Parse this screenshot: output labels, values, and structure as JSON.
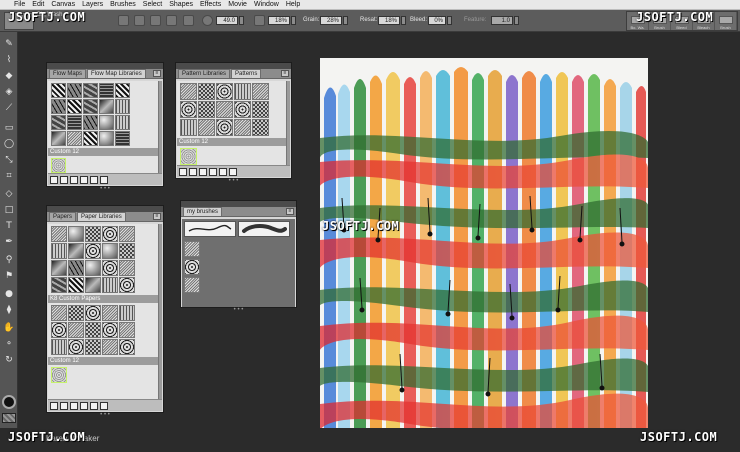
{
  "menu": [
    "File",
    "Edit",
    "Canvas",
    "Layers",
    "Brushes",
    "Select",
    "Shapes",
    "Effects",
    "Movie",
    "Window",
    "Help"
  ],
  "property_bar": {
    "brush_name": "Big Wash",
    "size_value": "49.0",
    "opacity_value": "18%",
    "grain_label": "Grain:",
    "grain_value": "28%",
    "resat_label": "Resat:",
    "resat_value": "18%",
    "bleed_label": "Bleed:",
    "bleed_value": "0%",
    "feature_label": "Feature:",
    "feature_value": "1.0"
  },
  "variants": [
    "Bo. Wa.",
    "Brush",
    "Bleed",
    "Bleach",
    "Brush"
  ],
  "panels": {
    "flow_maps": {
      "tabs": [
        "Flow Maps",
        "Flow Map Libraries"
      ],
      "section": "Custom 12"
    },
    "patterns": {
      "tabs": [
        "Pattern Libraries",
        "Patterns"
      ],
      "section": "Custom 12"
    },
    "papers": {
      "tabs": [
        "Papers",
        "Paper Libraries"
      ],
      "section_a": "K8 Custom Papers",
      "section_b": "Custom 12"
    },
    "my_brushes": {
      "tabs": [
        "my brushes"
      ]
    }
  },
  "footer_user": "Karen Bonaker",
  "watermark": "JSOFTJ.COM",
  "colors": {
    "accent_selection": "#c6f26a",
    "panel_bg": "#d7d7d7",
    "workspace_bg": "#2b2b2b"
  },
  "icons": [
    "pencil-icon",
    "brush-icon",
    "eraser-icon",
    "fill-icon",
    "eyedropper-icon",
    "selection-icon",
    "lasso-icon",
    "crop-icon",
    "text-icon",
    "hand-icon",
    "magnifier-icon",
    "rotate-icon"
  ]
}
